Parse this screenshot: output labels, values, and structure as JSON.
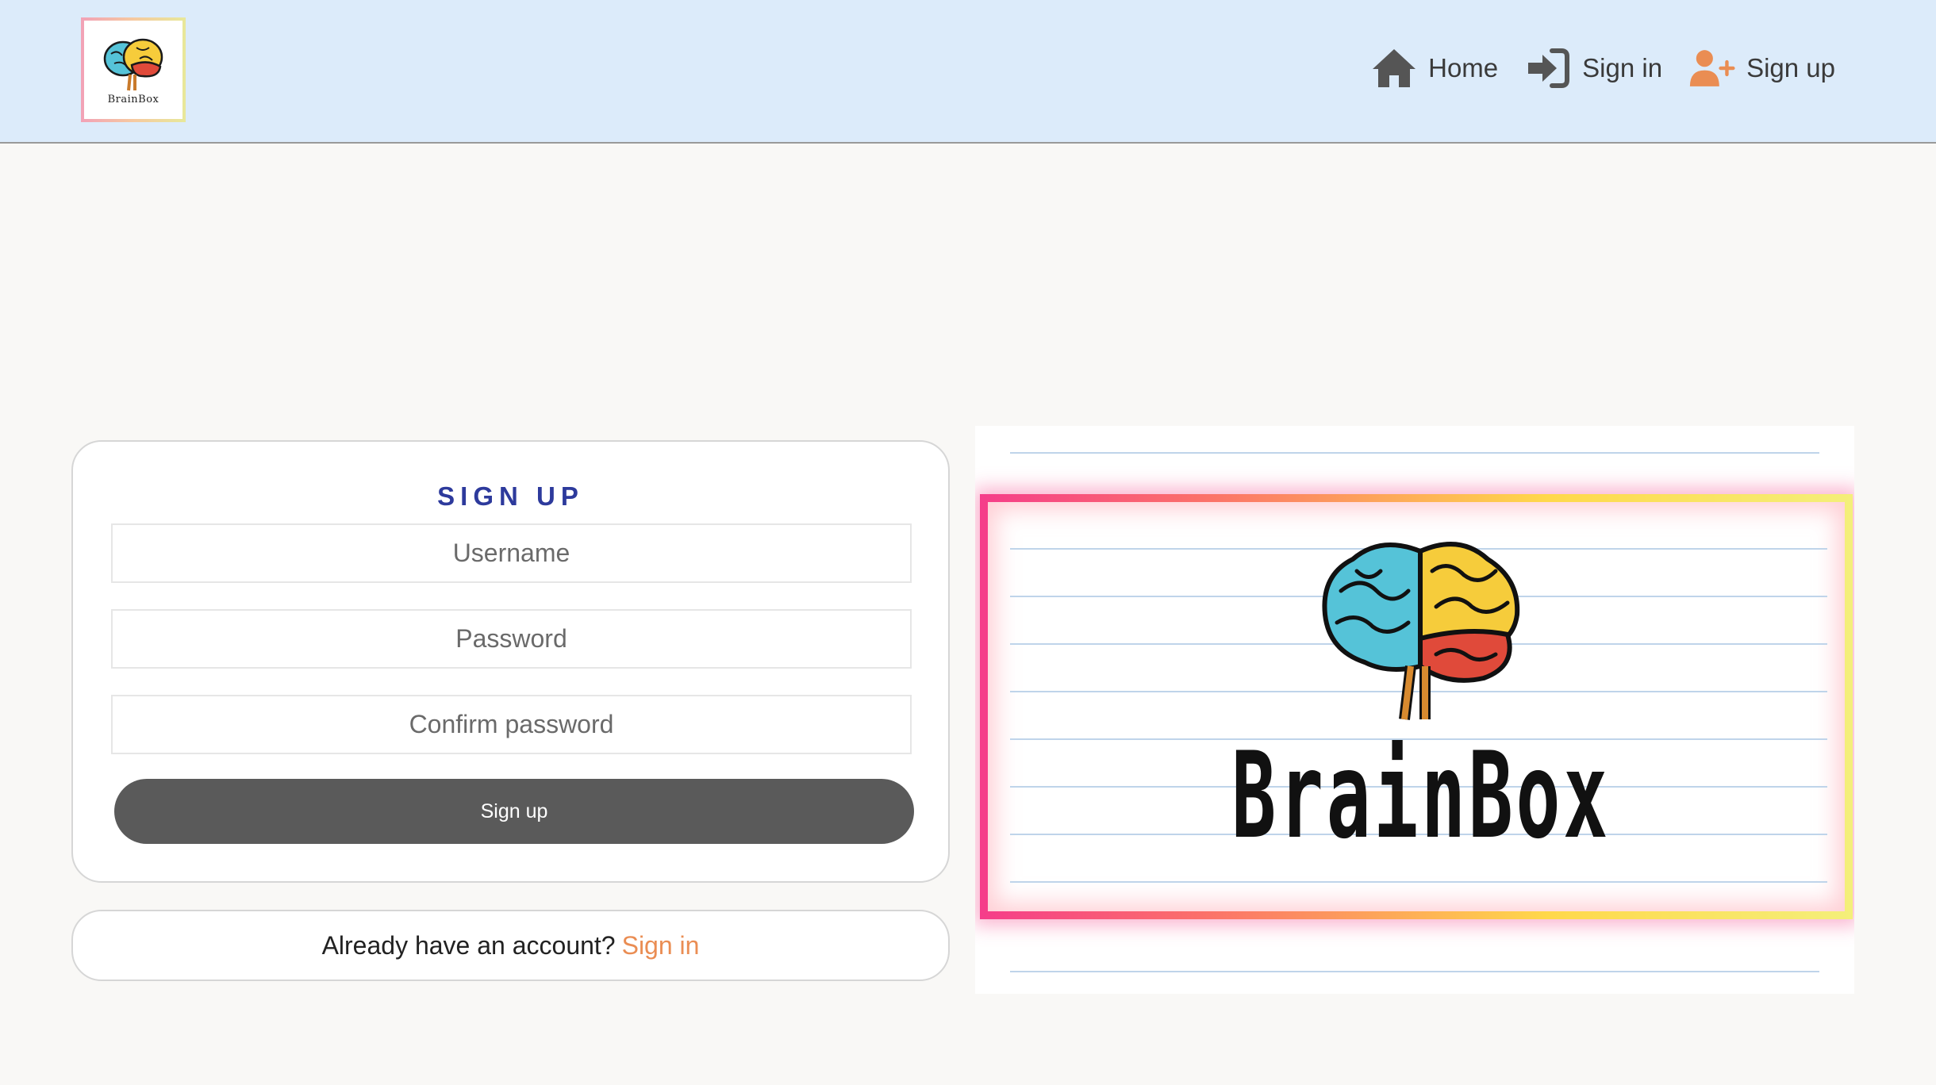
{
  "header": {
    "logo_text": "BrainBox",
    "nav": [
      {
        "label": "Home",
        "icon": "home-icon"
      },
      {
        "label": "Sign in",
        "icon": "sign-in-icon"
      },
      {
        "label": "Sign up",
        "icon": "user-plus-icon"
      }
    ]
  },
  "signup": {
    "title": "SIGN UP",
    "username_placeholder": "Username",
    "password_placeholder": "Password",
    "confirm_placeholder": "Confirm password",
    "submit_label": "Sign up"
  },
  "signin_prompt": {
    "text": "Already have an account?",
    "link": "Sign in"
  },
  "hero": {
    "brand": "BrainBox"
  },
  "colors": {
    "header_bg": "#dcebfa",
    "page_bg": "#f9f8f6",
    "title": "#2d3a9c",
    "link": "#ea8d53",
    "button": "#5a5a5a",
    "user_icon": "#ea8d53"
  }
}
